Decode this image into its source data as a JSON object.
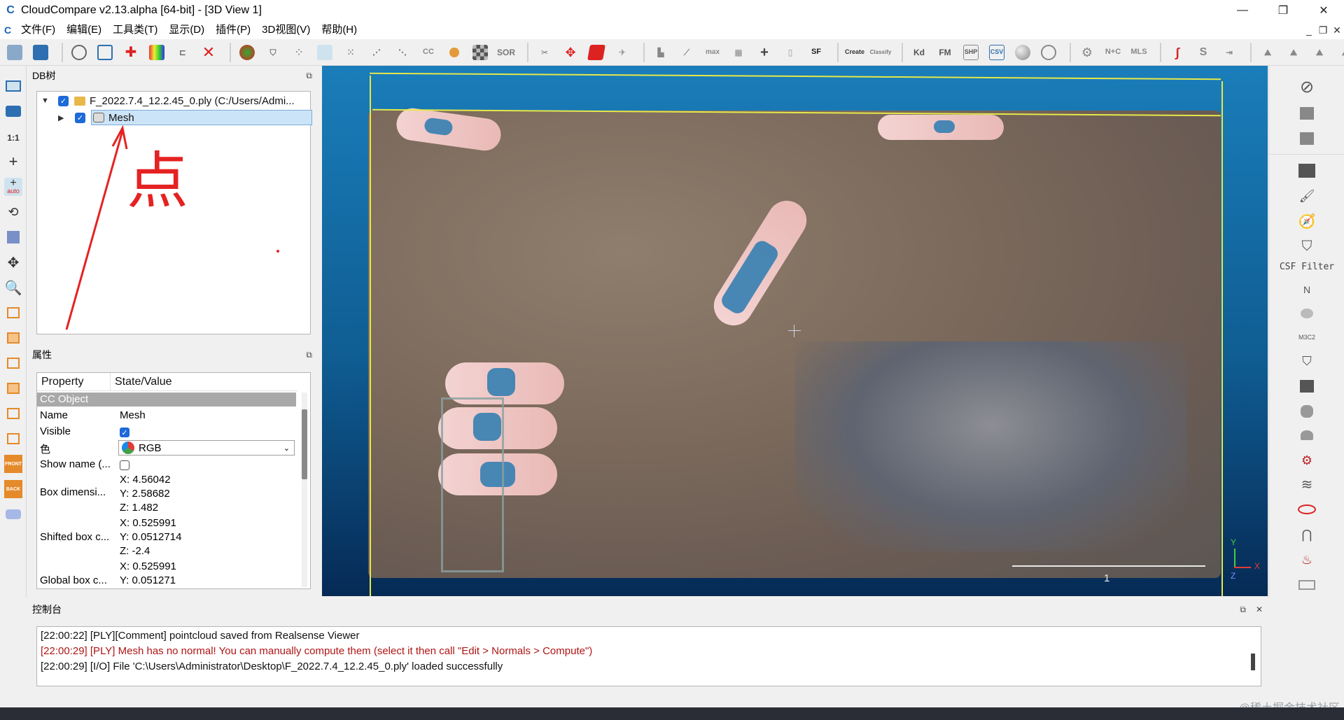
{
  "window": {
    "app_icon": "C",
    "title": "CloudCompare v2.13.alpha [64-bit] - [3D View 1]",
    "minimize": "—",
    "restore": "❐",
    "close": "✕"
  },
  "menu": {
    "items": [
      "文件(F)",
      "编辑(E)",
      "工具类(T)",
      "显示(D)",
      "插件(P)",
      "3D视图(V)",
      "帮助(H)"
    ],
    "mdi_buttons": [
      "_",
      "❐",
      "✕"
    ]
  },
  "toolbar": {
    "icons": [
      "open-icon",
      "save-icon",
      "settings-icon",
      "list-icon",
      "pick-point-icon",
      "color-scale-icon",
      "segment-icon",
      "delete-icon",
      "normals-icon",
      "shield-icon",
      "sample-icon",
      "subsample-icon",
      "noise-icon",
      "filter-icon",
      "scatter-icon",
      "cc-icon",
      "fill-icon",
      "checker-icon",
      "sor-icon",
      "scissors-icon",
      "translate-icon",
      "box-icon",
      "pin-icon",
      "histogram-icon",
      "plot-icon",
      "max-icon",
      "calc-icon",
      "plus-icon",
      "trash-icon",
      "sf-icon",
      "canupo-create-icon",
      "canupo-classify-icon",
      "kd-icon",
      "fm-icon",
      "shp-icon",
      "csv-icon",
      "sphere-icon",
      "globe-icon",
      "gear-icon",
      "nc-icon",
      "mls-icon",
      "s-icon",
      "s-dots-icon",
      "export-icon",
      "mountain-1-icon",
      "mountain-2-icon",
      "mountain-3-icon",
      "mountain-4-icon",
      "more-icon"
    ],
    "labels": {
      "sor": "SOR",
      "cc": "CC",
      "sf": "SF",
      "canupo_create": "Create",
      "canupo_classify": "Classify",
      "kd": "Kd",
      "fm": "FM",
      "nc": "N+C",
      "mls": "MLS",
      "more": "»"
    }
  },
  "left_toolbar": {
    "one_to_one": "1:1",
    "auto": "auto",
    "front": "FRONT",
    "back": "BACK"
  },
  "db_tree": {
    "title": "DB树",
    "float_btn": "⧉",
    "root": {
      "label": "F_2022.7.4_12.2.45_0.ply (C:/Users/Admi...",
      "checked": true,
      "expanded": true
    },
    "child": {
      "label": "Mesh",
      "checked": true,
      "expanded": false,
      "selected": true
    }
  },
  "properties": {
    "title": "属性",
    "float_btn": "⧉",
    "col_property": "Property",
    "col_value": "State/Value",
    "section": "CC Object",
    "name_k": "Name",
    "name_v": "Mesh",
    "visible_k": "Visible",
    "visible_v": true,
    "color_k": "色",
    "color_v": "RGB",
    "showname_k": "Show name (...",
    "showname_v": false,
    "boxdim_k": "Box dimensi...",
    "boxdim_x": "X: 4.56042",
    "boxdim_y": "Y: 2.58682",
    "boxdim_z": "Z: 1.482",
    "shifted_k": "Shifted box c...",
    "shifted_x": "X: 0.525991",
    "shifted_y": "Y: 0.0512714",
    "shifted_z": "Z: -2.4",
    "global_k": "Global box c...",
    "global_x": "X: 0.525991",
    "global_y": "Y: 0.051271"
  },
  "annotation": {
    "handwriting": "点"
  },
  "view": {
    "axis_y": "Y",
    "axis_x": "X",
    "axis_z": "Z",
    "scale_label": "1"
  },
  "right_toolbar": {
    "csf_label": "CSF Filter",
    "n_label": "N",
    "m3c2": "M3C2"
  },
  "console": {
    "title": "控制台",
    "float_btn": "⧉",
    "close_btn": "✕",
    "lines": [
      {
        "text": "[22:00:22] [PLY][Comment] pointcloud saved from Realsense Viewer",
        "level": "info"
      },
      {
        "text": "[22:00:29] [PLY] Mesh has no normal! You can manually compute them (select it then call \"Edit > Normals > Compute\")",
        "level": "error"
      },
      {
        "text": "[22:00:29] [I/O] File 'C:\\Users\\Administrator\\Desktop\\F_2022.7.4_12.2.45_0.ply' loaded successfully",
        "level": "info"
      }
    ]
  },
  "watermark": "@稀土掘金技术社区",
  "colors": {
    "accent": "#1d6ad8",
    "error": "#b01515",
    "bbox": "#e6e84a",
    "annotation": "#e52222"
  }
}
